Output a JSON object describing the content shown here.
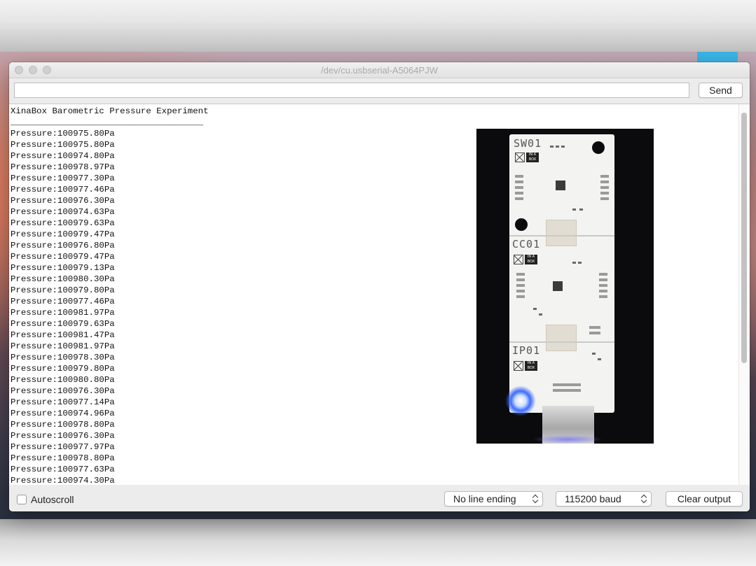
{
  "window": {
    "title": "/dev/cu.usbserial-A5064PJW"
  },
  "input": {
    "value": "",
    "send_label": "Send"
  },
  "output": {
    "lines": [
      "XinaBox Barometric Pressure Experiment",
      "_____________________________________",
      "Pressure:100975.80Pa",
      "Pressure:100975.80Pa",
      "Pressure:100974.80Pa",
      "Pressure:100978.97Pa",
      "Pressure:100977.30Pa",
      "Pressure:100977.46Pa",
      "Pressure:100976.30Pa",
      "Pressure:100974.63Pa",
      "Pressure:100979.63Pa",
      "Pressure:100979.47Pa",
      "Pressure:100976.80Pa",
      "Pressure:100979.47Pa",
      "Pressure:100979.13Pa",
      "Pressure:100980.30Pa",
      "Pressure:100979.80Pa",
      "Pressure:100977.46Pa",
      "Pressure:100981.97Pa",
      "Pressure:100979.63Pa",
      "Pressure:100981.47Pa",
      "Pressure:100981.97Pa",
      "Pressure:100978.30Pa",
      "Pressure:100979.80Pa",
      "Pressure:100980.80Pa",
      "Pressure:100976.30Pa",
      "Pressure:100977.14Pa",
      "Pressure:100974.96Pa",
      "Pressure:100978.80Pa",
      "Pressure:100976.30Pa",
      "Pressure:100977.97Pa",
      "Pressure:100978.80Pa",
      "Pressure:100977.63Pa",
      "Pressure:100974.30Pa"
    ]
  },
  "photo": {
    "modules": [
      "SW01",
      "CC01",
      "IP01"
    ],
    "badge_text": "IN A BOX"
  },
  "footer": {
    "autoscroll_label": "Autoscroll",
    "autoscroll_checked": false,
    "line_ending": "No line ending",
    "baud": "115200 baud",
    "clear_label": "Clear output"
  },
  "colors": {
    "led": "#3e6cff",
    "desktop_accent": "#3cb4e6"
  }
}
